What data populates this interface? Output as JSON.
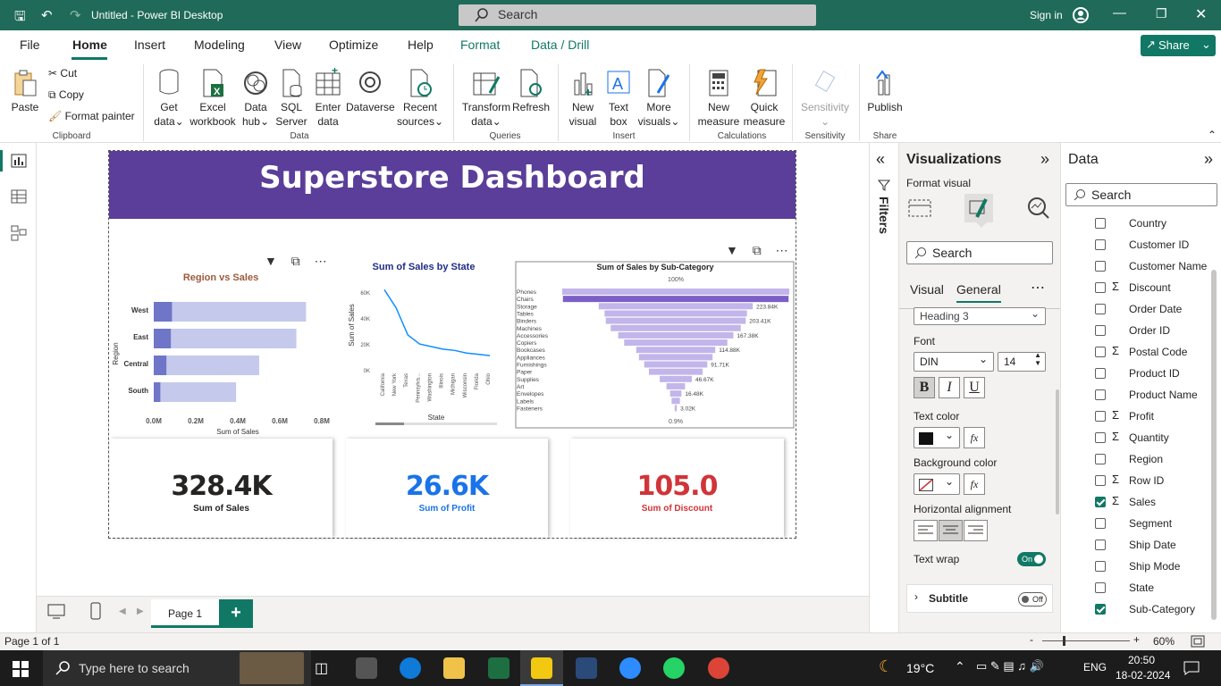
{
  "app": {
    "title": "Untitled - Power BI Desktop",
    "search": "Search",
    "signin": "Sign in"
  },
  "menu": {
    "file": "File",
    "home": "Home",
    "insert": "Insert",
    "modeling": "Modeling",
    "view": "View",
    "optimize": "Optimize",
    "help": "Help",
    "format": "Format",
    "datadrill": "Data / Drill",
    "share": "Share"
  },
  "ribbon": {
    "paste": "Paste",
    "cut": "Cut",
    "copy": "Copy",
    "format_painter": "Format painter",
    "clipboard": "Clipboard",
    "get_data": "Get",
    "get_data2": "data",
    "excel": "Excel",
    "excel2": "workbook",
    "datahub": "Data",
    "datahub2": "hub",
    "sql": "SQL",
    "sql2": "Server",
    "enter": "Enter",
    "enter2": "data",
    "dataverse": "Dataverse",
    "recent": "Recent",
    "recent2": "sources",
    "data_group": "Data",
    "transform": "Transform",
    "transform2": "data",
    "refresh": "Refresh",
    "queries": "Queries",
    "newvisual": "New",
    "newvisual2": "visual",
    "textbox": "Text",
    "textbox2": "box",
    "morevisuals": "More",
    "morevisuals2": "visuals",
    "insert_group": "Insert",
    "newmeasure": "New",
    "newmeasure2": "measure",
    "quickmeasure": "Quick",
    "quickmeasure2": "measure",
    "calculations": "Calculations",
    "sensitivity": "Sensitivity",
    "sensitivity_group": "Sensitivity",
    "publish": "Publish",
    "share_group": "Share"
  },
  "report": {
    "title": "Superstore Dashboard"
  },
  "charts": {
    "region": {
      "title": "Region vs Sales",
      "ylabel": "Region",
      "xlabel": "Sum of Sales",
      "ticks": [
        "0.0M",
        "0.2M",
        "0.4M",
        "0.6M",
        "0.8M"
      ]
    },
    "state": {
      "title": "Sum of Sales by State",
      "ylabel": "Sum of Sales",
      "xlabel": "State",
      "yticks": [
        "60K",
        "40K",
        "20K",
        "0K"
      ]
    },
    "subcat": {
      "title": "Sum of Sales by Sub-Category",
      "top": "100%",
      "bottom": "0.9%"
    }
  },
  "chart_data": [
    {
      "type": "bar",
      "title": "Region vs Sales",
      "categories": [
        "West",
        "East",
        "Central",
        "South"
      ],
      "series": [
        {
          "values": [
            0.725,
            0.679,
            0.502,
            0.392
          ]
        }
      ],
      "xlabel": "Sum of Sales",
      "ylabel": "Region",
      "xlim": [
        0,
        0.8
      ],
      "unit": "M"
    },
    {
      "type": "line",
      "title": "Sum of Sales by State",
      "categories": [
        "California",
        "New York",
        "Texas",
        "Pennsylva...",
        "Washington",
        "Illinois",
        "Michigan",
        "Wisconsin",
        "Florida",
        "Ohio"
      ],
      "values": [
        62,
        48,
        27,
        20,
        18,
        16,
        15,
        13,
        12,
        11
      ],
      "ylim": [
        0,
        65
      ],
      "xlabel": "State",
      "ylabel": "Sum of Sales",
      "unit": "K"
    },
    {
      "type": "bar",
      "title": "Sum of Sales by Sub-Category",
      "categories": [
        "Phones",
        "Chairs",
        "Storage",
        "Tables",
        "Binders",
        "Machines",
        "Accessories",
        "Copiers",
        "Bookcases",
        "Appliances",
        "Furnishings",
        "Paper",
        "Supplies",
        "Art",
        "Envelopes",
        "Labels",
        "Fasteners"
      ],
      "values": [
        330,
        328,
        223.84,
        207,
        203.41,
        189,
        167.38,
        150,
        114.88,
        107,
        91.71,
        78,
        46.67,
        27,
        16.48,
        12,
        3.02
      ],
      "labels": [
        "",
        "",
        "223.84K",
        "",
        "203.41K",
        "",
        "167.38K",
        "",
        "114.88K",
        "",
        "91.71K",
        "",
        "46.67K",
        "",
        "16.48K",
        "",
        "3.02K"
      ],
      "unit": "K"
    }
  ],
  "kpis": [
    {
      "value": "328.4K",
      "label": "Sum of Sales",
      "color": "#000000"
    },
    {
      "value": "26.6K",
      "label": "Sum of Profit",
      "color": "#1a73e8"
    },
    {
      "value": "105.0",
      "label": "Sum of Discount",
      "color": "#d13438"
    }
  ],
  "pages": {
    "tab": "Page 1",
    "status": "Page 1 of 1",
    "zoom": "60%"
  },
  "filters": {
    "label": "Filters"
  },
  "viz": {
    "title": "Visualizations",
    "format_visual": "Format visual",
    "search": "Search",
    "tab_visual": "Visual",
    "tab_general": "General",
    "heading": "Heading 3",
    "font_label": "Font",
    "font": "DIN",
    "size": "14",
    "text_color": "Text color",
    "bg_color": "Background color",
    "halign": "Horizontal alignment",
    "text_wrap": "Text wrap",
    "wrap_state": "On",
    "subtitle": "Subtitle",
    "subtitle_state": "Off",
    "fx": "fx"
  },
  "data": {
    "title": "Data",
    "search": "Search",
    "fields": [
      {
        "name": "Country",
        "sigma": false,
        "checked": false
      },
      {
        "name": "Customer ID",
        "sigma": false,
        "checked": false
      },
      {
        "name": "Customer Name",
        "sigma": false,
        "checked": false
      },
      {
        "name": "Discount",
        "sigma": true,
        "checked": false
      },
      {
        "name": "Order Date",
        "sigma": false,
        "checked": false
      },
      {
        "name": "Order ID",
        "sigma": false,
        "checked": false
      },
      {
        "name": "Postal Code",
        "sigma": true,
        "checked": false
      },
      {
        "name": "Product ID",
        "sigma": false,
        "checked": false
      },
      {
        "name": "Product Name",
        "sigma": false,
        "checked": false
      },
      {
        "name": "Profit",
        "sigma": true,
        "checked": false
      },
      {
        "name": "Quantity",
        "sigma": true,
        "checked": false
      },
      {
        "name": "Region",
        "sigma": false,
        "checked": false
      },
      {
        "name": "Row ID",
        "sigma": true,
        "checked": false
      },
      {
        "name": "Sales",
        "sigma": true,
        "checked": true
      },
      {
        "name": "Segment",
        "sigma": false,
        "checked": false
      },
      {
        "name": "Ship Date",
        "sigma": false,
        "checked": false
      },
      {
        "name": "Ship Mode",
        "sigma": false,
        "checked": false
      },
      {
        "name": "State",
        "sigma": false,
        "checked": false
      },
      {
        "name": "Sub-Category",
        "sigma": false,
        "checked": true
      }
    ]
  },
  "taskbar": {
    "search": "Type here to search",
    "weather": "19°C",
    "lang": "ENG",
    "time": "20:50",
    "date": "18-02-2024"
  }
}
